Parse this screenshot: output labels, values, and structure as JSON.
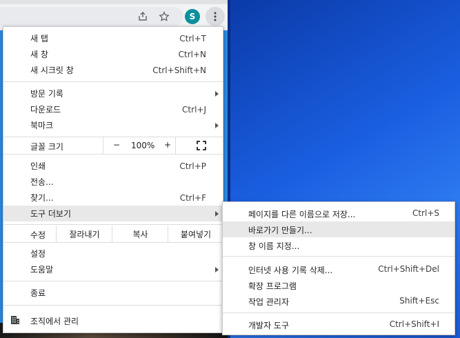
{
  "profile": {
    "initial": "S"
  },
  "menu": {
    "items_group1": [
      {
        "label": "새 탭",
        "shortcut": "Ctrl+T"
      },
      {
        "label": "새 창",
        "shortcut": "Ctrl+N"
      },
      {
        "label": "새 시크릿 창",
        "shortcut": "Ctrl+Shift+N"
      }
    ],
    "items_group2": [
      {
        "label": "방문 기록",
        "shortcut": ""
      },
      {
        "label": "다운로드",
        "shortcut": "Ctrl+J"
      },
      {
        "label": "북마크",
        "shortcut": ""
      }
    ],
    "zoom": {
      "label": "글꼴 크기",
      "minus": "−",
      "value": "100%",
      "plus": "+"
    },
    "items_group3": [
      {
        "label": "인쇄",
        "shortcut": "Ctrl+P"
      },
      {
        "label": "전송...",
        "shortcut": ""
      },
      {
        "label": "찾기...",
        "shortcut": "Ctrl+F"
      },
      {
        "label": "도구 더보기",
        "shortcut": ""
      }
    ],
    "edit": {
      "label": "수정",
      "cut": "잘라내기",
      "copy": "복사",
      "paste": "붙여넣기"
    },
    "items_group4": [
      {
        "label": "설정"
      },
      {
        "label": "도움말"
      }
    ],
    "exit": {
      "label": "종료"
    },
    "managed": {
      "label": "조직에서 관리"
    }
  },
  "submenu": {
    "group1": [
      {
        "label": "페이지를 다른 이름으로 저장...",
        "shortcut": "Ctrl+S"
      },
      {
        "label": "바로가기 만들기...",
        "shortcut": ""
      },
      {
        "label": "창 이름 지정...",
        "shortcut": ""
      }
    ],
    "group2": [
      {
        "label": "인터넷 사용 기록 삭제...",
        "shortcut": "Ctrl+Shift+Del"
      },
      {
        "label": "확장 프로그램",
        "shortcut": ""
      },
      {
        "label": "작업 관리자",
        "shortcut": "Shift+Esc"
      }
    ],
    "group3": [
      {
        "label": "개발자 도구",
        "shortcut": "Ctrl+Shift+I"
      }
    ]
  },
  "colors": {
    "avatar": "#0c8f9c",
    "hover": "#e8e8e8",
    "desktop": "#1a5ee0"
  },
  "icons": [
    "share-icon",
    "star-icon",
    "kebab-menu-icon",
    "fullscreen-icon",
    "building-icon",
    "submenu-arrow-icon"
  ]
}
